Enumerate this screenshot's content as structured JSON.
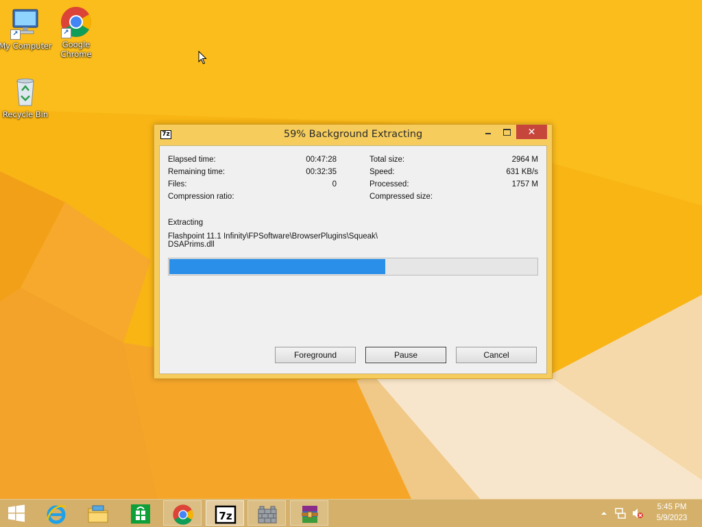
{
  "desktop": {
    "icons": [
      {
        "label": "My Computer",
        "icon": "computer-icon"
      },
      {
        "label": "Google Chrome",
        "icon": "chrome-icon"
      },
      {
        "label": "Recycle Bin",
        "icon": "recycle-bin-icon"
      }
    ]
  },
  "window": {
    "title": "59% Background Extracting",
    "app_icon": "7z",
    "controls": {
      "minimize": "minimize-icon",
      "maximize": "maximize-icon",
      "close": "close-icon"
    },
    "stats_left": [
      {
        "label": "Elapsed time:",
        "value": "00:47:28"
      },
      {
        "label": "Remaining time:",
        "value": "00:32:35"
      },
      {
        "label": "Files:",
        "value": "0"
      },
      {
        "label": "Compression ratio:",
        "value": ""
      }
    ],
    "stats_right": [
      {
        "label": "Total size:",
        "value": "2964 M"
      },
      {
        "label": "Speed:",
        "value": "631 KB/s"
      },
      {
        "label": "Processed:",
        "value": "1757 M"
      },
      {
        "label": "Compressed size:",
        "value": ""
      }
    ],
    "operation": "Extracting",
    "current_file_line1": "Flashpoint 11.1 Infinity\\FPSoftware\\BrowserPlugins\\Squeak\\",
    "current_file_line2": "DSAPrims.dll",
    "progress_percent": 59,
    "buttons": {
      "foreground": "Foreground",
      "pause": "Pause",
      "cancel": "Cancel"
    }
  },
  "taskbar": {
    "items": [
      {
        "name": "start",
        "icon": "windows-logo-icon"
      },
      {
        "name": "internet-explorer",
        "icon": "ie-icon"
      },
      {
        "name": "file-explorer",
        "icon": "folder-icon"
      },
      {
        "name": "store",
        "icon": "store-icon"
      },
      {
        "name": "chrome",
        "icon": "chrome-icon"
      },
      {
        "name": "7zip",
        "icon": "7zip-icon"
      },
      {
        "name": "firewall",
        "icon": "brick-wall-icon"
      },
      {
        "name": "winrar",
        "icon": "winrar-icon"
      }
    ],
    "clock": {
      "time": "5:45 PM",
      "date": "5/9/2023"
    },
    "tray_icons": [
      "show-hidden-icons-icon",
      "network-icon",
      "volume-muted-icon"
    ]
  },
  "colors": {
    "accent": "#f7b20e",
    "progress": "#2a8fe8",
    "close": "#c7463c"
  }
}
